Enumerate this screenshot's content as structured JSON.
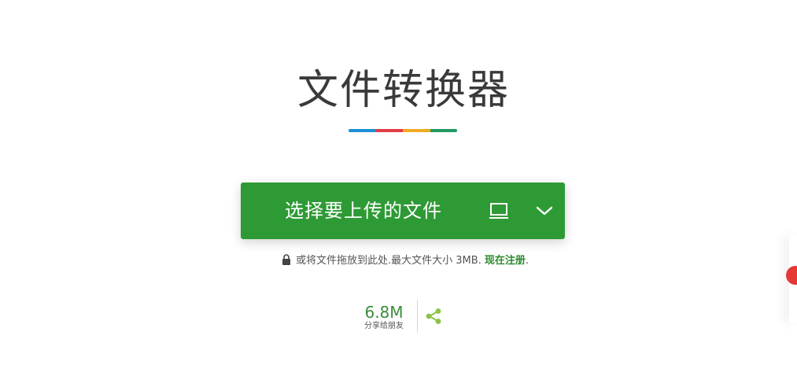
{
  "page": {
    "title": "文件转换器",
    "title_bar_colors": [
      "#1a8fd6",
      "#e33b45",
      "#f0aa22",
      "#1f9a63"
    ]
  },
  "upload": {
    "label": "选择要上传的文件",
    "color": "#2e9a35",
    "device_icon": "device-icon",
    "dropdown_icon": "chevron-down-icon"
  },
  "note": {
    "icon": "lock-icon",
    "text": "或将文件拖放到此处.最大文件大小 3MB.",
    "link": "现在注册",
    "suffix": "."
  },
  "share": {
    "count": "6.8M",
    "label": "分享给朋友",
    "icon": "share-icon",
    "icon_color": "#8bc34a"
  },
  "edge": {
    "badge_color": "#e53935"
  }
}
